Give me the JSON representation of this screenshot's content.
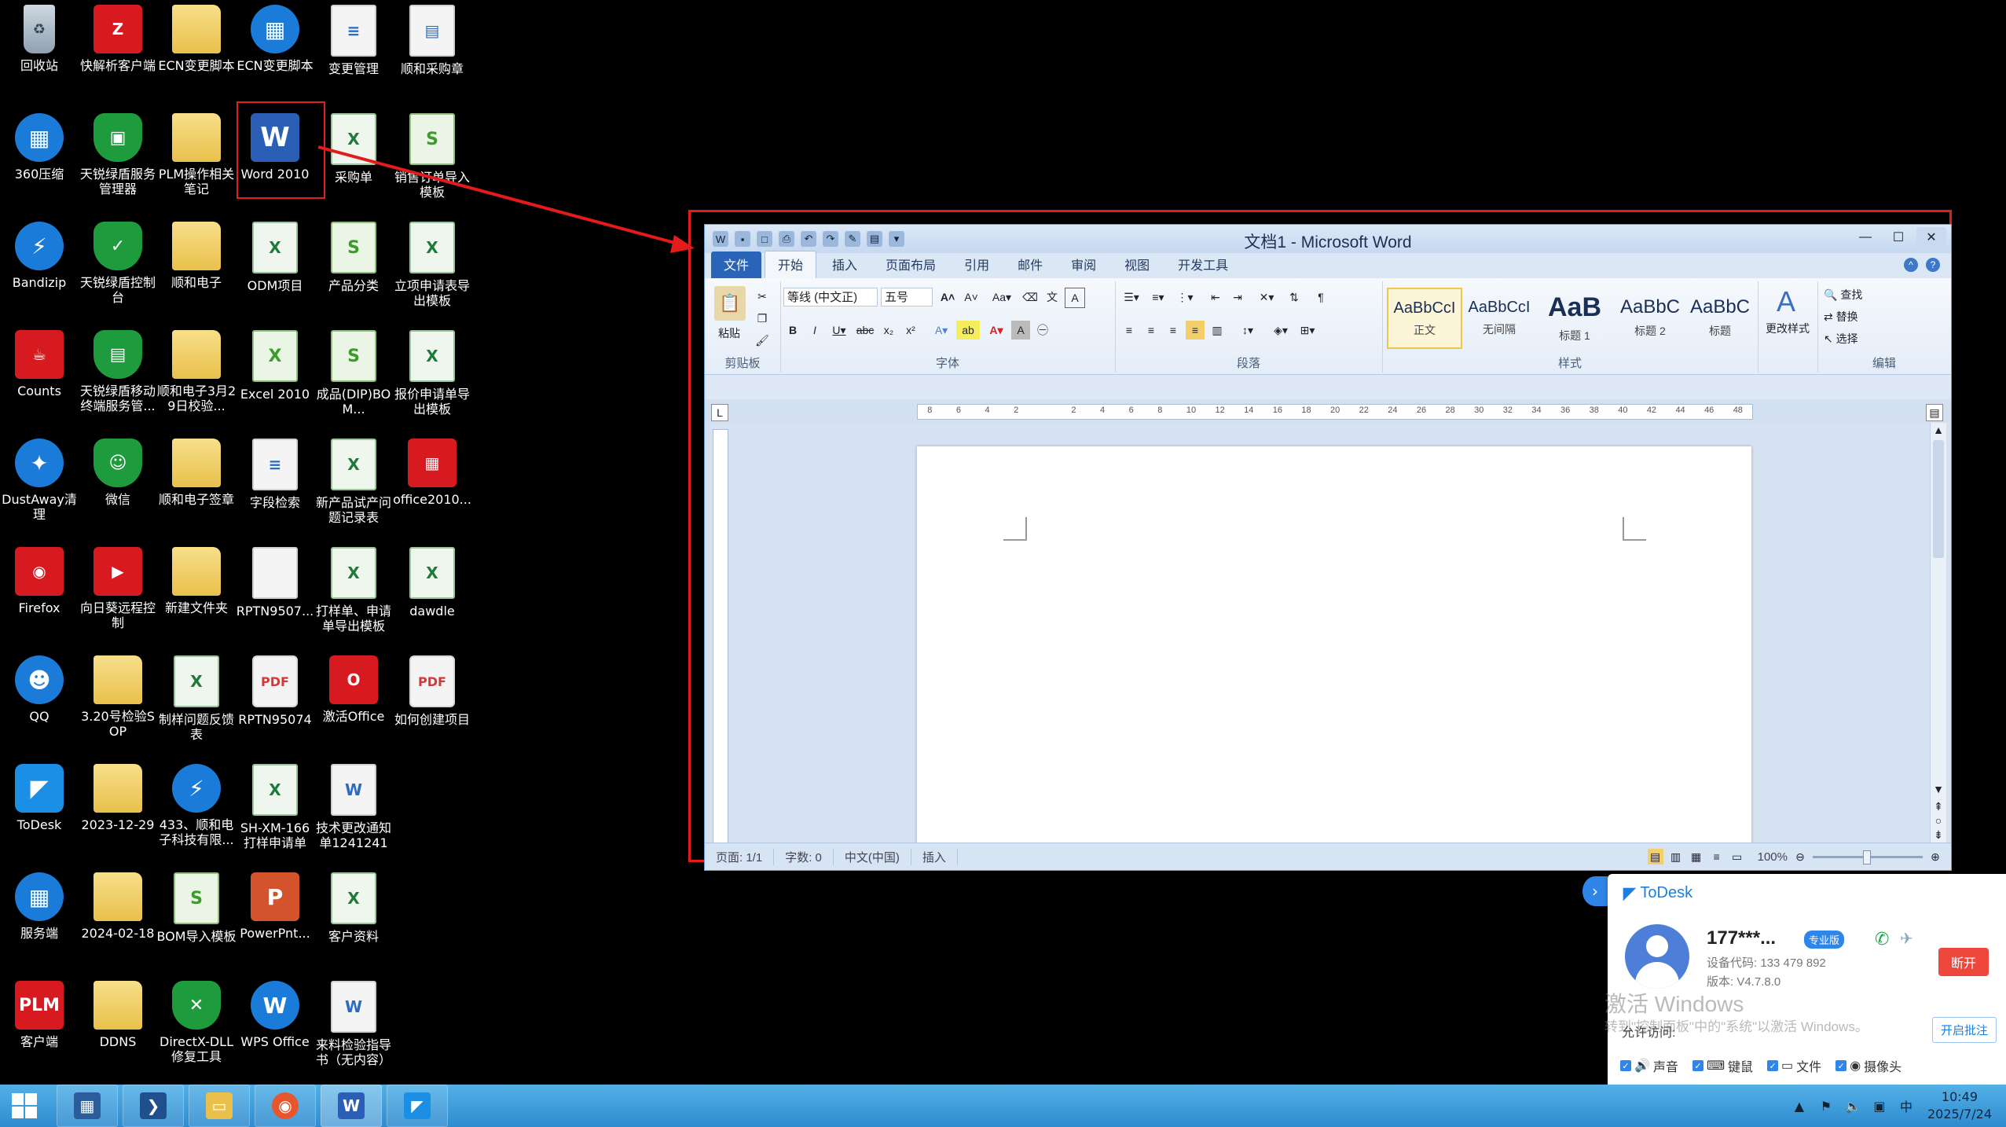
{
  "desktop": {
    "icons": [
      {
        "label": "回收站"
      },
      {
        "label": "快解析客户端"
      },
      {
        "label": "ECN变更脚本"
      },
      {
        "label": "ECN变更脚本"
      },
      {
        "label": "变更管理"
      },
      {
        "label": "顺和采购章"
      },
      {
        "label": "360压缩"
      },
      {
        "label": "天锐绿盾服务管理器"
      },
      {
        "label": "PLM操作相关笔记"
      },
      {
        "label": "Word 2010"
      },
      {
        "label": "采购单"
      },
      {
        "label": "销售订单导入模板"
      },
      {
        "label": "Bandizip"
      },
      {
        "label": "天锐绿盾控制台"
      },
      {
        "label": "顺和电子"
      },
      {
        "label": "ODM项目"
      },
      {
        "label": "产品分类"
      },
      {
        "label": "立项申请表导出模板"
      },
      {
        "label": "Counts"
      },
      {
        "label": "天锐绿盾移动终端服务管..."
      },
      {
        "label": "顺和电子3月29日校验..."
      },
      {
        "label": "Excel 2010"
      },
      {
        "label": "成品(DIP)BOM..."
      },
      {
        "label": "报价申请单导出模板"
      },
      {
        "label": "DustAway清理"
      },
      {
        "label": "微信"
      },
      {
        "label": "顺和电子签章"
      },
      {
        "label": "字段检索"
      },
      {
        "label": "新产品试产问题记录表"
      },
      {
        "label": "office2010..."
      },
      {
        "label": "Firefox"
      },
      {
        "label": "向日葵远程控制"
      },
      {
        "label": "新建文件夹"
      },
      {
        "label": "RPTN9507..."
      },
      {
        "label": "打样单、申请单导出模板"
      },
      {
        "label": "dawdle"
      },
      {
        "label": "QQ"
      },
      {
        "label": "3.20号检验SOP"
      },
      {
        "label": "制样问题反馈表"
      },
      {
        "label": "RPTN95074"
      },
      {
        "label": "激活Office"
      },
      {
        "label": "如何创建项目"
      },
      {
        "label": "ToDesk"
      },
      {
        "label": "2023-12-29"
      },
      {
        "label": "433、顺和电子科技有限..."
      },
      {
        "label": "SH-XM-166打样申请单"
      },
      {
        "label": "技术更改通知单1241241"
      },
      {
        "label": "服务端"
      },
      {
        "label": "2024-02-18"
      },
      {
        "label": "BOM导入模板"
      },
      {
        "label": "PowerPnt..."
      },
      {
        "label": "客户资料"
      },
      {
        "label": "客户端"
      },
      {
        "label": "DDNS"
      },
      {
        "label": "DirectX-DLL修复工具"
      },
      {
        "label": "WPS Office"
      },
      {
        "label": "来料检验指导书（无内容）"
      }
    ]
  },
  "word": {
    "title": "文档1 - Microsoft Word",
    "tabs": [
      "文件",
      "开始",
      "插入",
      "页面布局",
      "引用",
      "邮件",
      "审阅",
      "视图",
      "开发工具"
    ],
    "clipboard": {
      "paste": "粘贴",
      "group": "剪贴板"
    },
    "font": {
      "name": "等线 (中文正)",
      "size": "五号",
      "group": "字体"
    },
    "paragraph": {
      "group": "段落"
    },
    "styles": {
      "items": [
        {
          "sample": "AaBbCcI",
          "name": "正文"
        },
        {
          "sample": "AaBbCcI",
          "name": "无间隔"
        },
        {
          "sample": "AaB",
          "name": "标题 1"
        },
        {
          "sample": "AaBbC",
          "name": "标题 2"
        },
        {
          "sample": "AaBbC",
          "name": "标题"
        }
      ],
      "change": "更改样式",
      "group": "样式"
    },
    "editing": {
      "find": "查找",
      "replace": "替换",
      "select": "选择",
      "group": "编辑"
    },
    "ruler_labels": [
      "8",
      "6",
      "4",
      "2",
      "",
      "2",
      "4",
      "6",
      "8",
      "10",
      "12",
      "14",
      "16",
      "18",
      "20",
      "22",
      "24",
      "26",
      "28",
      "30",
      "32",
      "34",
      "36",
      "38",
      "40",
      "42",
      "44",
      "46",
      "48"
    ],
    "status": {
      "page": "页面: 1/1",
      "words": "字数: 0",
      "lang": "中文(中国)",
      "mode": "插入",
      "zoom": "100%"
    }
  },
  "todesk": {
    "brand": "ToDesk",
    "user": "177***...",
    "badge": "专业版",
    "device_code": "设备代码: 133 479 892",
    "version": "版本: V4.7.8.0",
    "disconnect": "断开",
    "allow_access": "允许访问:",
    "enable_annotation": "开启批注",
    "perms": [
      "声音",
      "键鼠",
      "文件",
      "摄像头"
    ],
    "watermark1": "激活 Windows",
    "watermark2": "转到\"控制面板\"中的\"系统\"以激活 Windows。"
  },
  "taskbar": {
    "time": "10:49",
    "date": "2025/7/24"
  }
}
